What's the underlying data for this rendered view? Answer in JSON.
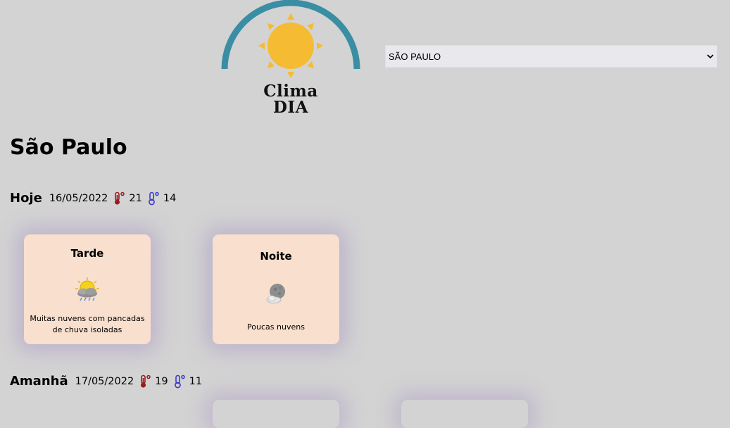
{
  "logo": {
    "line1": "Clima",
    "line2": "DIA",
    "arc_color": "#3a8ea3",
    "sun_color": "#f5bc33"
  },
  "city_select": {
    "selected": "SÃO PAULO"
  },
  "city_title": "São Paulo",
  "today": {
    "label": "Hoje",
    "date": "16/05/2022",
    "max": "21",
    "min": "14",
    "periods": [
      {
        "title": "Tarde",
        "icon": "cloud-sun-rain-icon",
        "desc": "Muitas nuvens com pancadas de chuva isoladas"
      },
      {
        "title": "Noite",
        "icon": "cloud-moon-icon",
        "desc": "Poucas nuvens"
      }
    ]
  },
  "tomorrow": {
    "label": "Amanhã",
    "date": "17/05/2022",
    "max": "19",
    "min": "11"
  },
  "colors": {
    "background": "#d3d3d3",
    "card": "#f8dfce",
    "temp_max": "#9b1b1b",
    "temp_min": "#3a3ad0"
  }
}
